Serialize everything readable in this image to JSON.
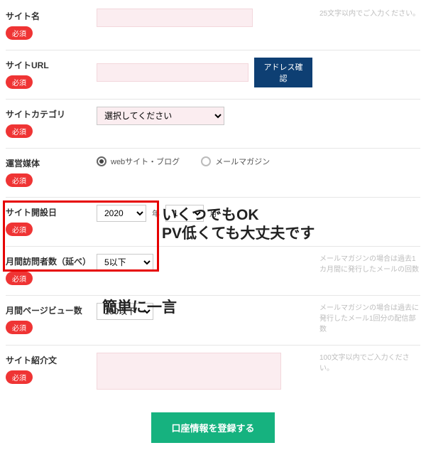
{
  "badge_required": "必須",
  "site_name": {
    "label": "サイト名",
    "value": "",
    "hint": "25文字以内でご入力ください。"
  },
  "site_url": {
    "label": "サイトURL",
    "value": "",
    "check_btn": "アドレス確認"
  },
  "site_category": {
    "label": "サイトカテゴリ",
    "selected": "選択してください"
  },
  "media_type": {
    "label": "運営媒体",
    "option_web": "webサイト・ブログ",
    "option_mail": "メールマガジン"
  },
  "open_date": {
    "label": "サイト開設日",
    "year": "2020",
    "year_unit": "年",
    "month": "1",
    "month_unit": "月"
  },
  "visitors": {
    "label": "月間訪問者数（延べ）",
    "selected": "5以下",
    "hint": "メールマガジンの場合は過去1カ月間に発行したメールの回数"
  },
  "pageviews": {
    "label": "月間ページビュー数",
    "selected": "100以下",
    "hint": "メールマガジンの場合は過去に発行したメール1回分の配信部数"
  },
  "intro": {
    "label": "サイト紹介文",
    "value": "",
    "hint": "100文字以内でご入力ください。"
  },
  "submit_label": "口座情報を登録する",
  "annotations": {
    "ok_text": "いくつでもOK\nPV低くても大丈夫です",
    "intro_text": "簡単に一言"
  }
}
